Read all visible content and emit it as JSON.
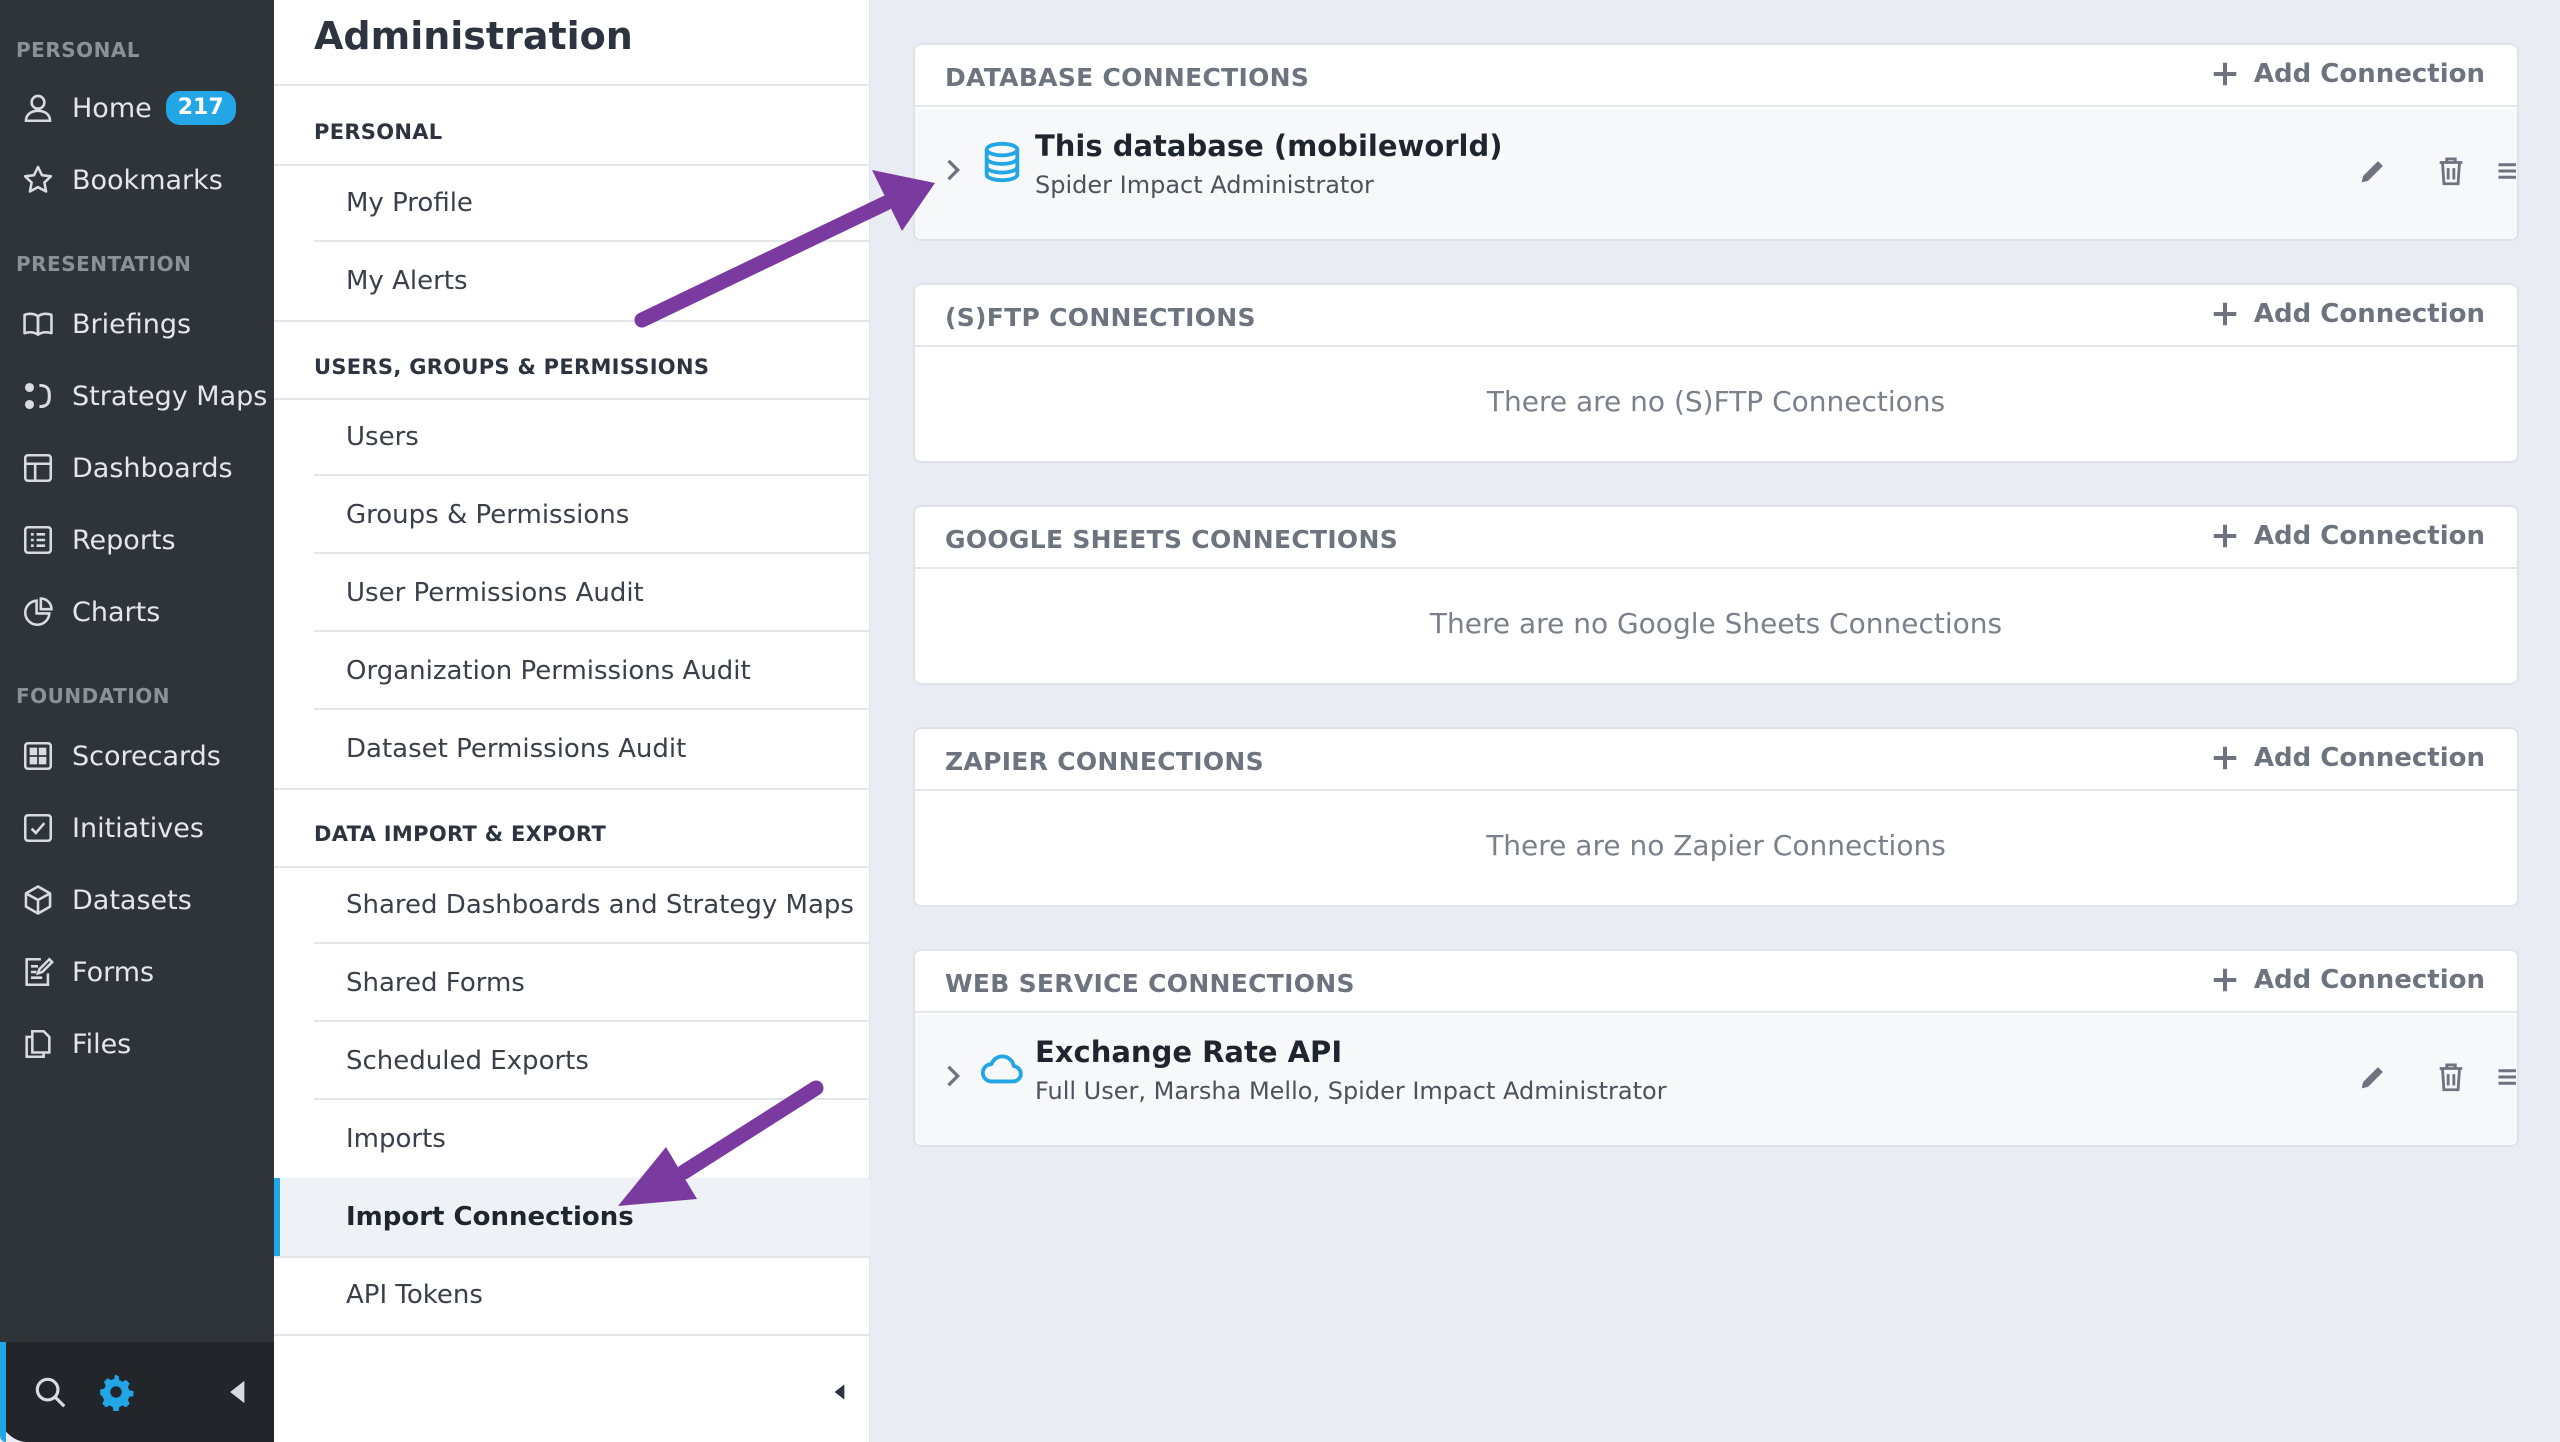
{
  "sidebar": {
    "sections": [
      "PERSONAL",
      "PRESENTATION",
      "FOUNDATION"
    ],
    "items": [
      {
        "label": "Home",
        "icon": "user-icon",
        "badge": "217"
      },
      {
        "label": "Bookmarks",
        "icon": "star-icon"
      },
      {
        "label": "Briefings",
        "icon": "book-icon"
      },
      {
        "label": "Strategy Maps",
        "icon": "strategy-map-icon"
      },
      {
        "label": "Dashboards",
        "icon": "dashboard-icon"
      },
      {
        "label": "Reports",
        "icon": "report-icon"
      },
      {
        "label": "Charts",
        "icon": "pie-chart-icon"
      },
      {
        "label": "Scorecards",
        "icon": "scorecard-icon"
      },
      {
        "label": "Initiatives",
        "icon": "checkbox-icon"
      },
      {
        "label": "Datasets",
        "icon": "cube-icon"
      },
      {
        "label": "Forms",
        "icon": "form-icon"
      },
      {
        "label": "Files",
        "icon": "files-icon"
      }
    ],
    "bottom": {
      "search_icon": "search-icon",
      "settings_icon": "gear-icon",
      "collapse_icon": "caret-left-icon"
    }
  },
  "admin": {
    "title": "Administration",
    "sections": [
      "PERSONAL",
      "USERS, GROUPS & PERMISSIONS",
      "DATA IMPORT & EXPORT"
    ],
    "items": [
      "My Profile",
      "My Alerts",
      "Users",
      "Groups & Permissions",
      "User Permissions Audit",
      "Organization Permissions Audit",
      "Dataset Permissions Audit",
      "Shared Dashboards and Strategy Maps",
      "Shared Forms",
      "Scheduled Exports",
      "Imports",
      "Import Connections",
      "API Tokens"
    ],
    "active_item": "Import Connections"
  },
  "cards": {
    "add_label": "Add Connection",
    "database": {
      "title": "DATABASE CONNECTIONS",
      "row": {
        "name": "This database (mobileworld)",
        "sub": "Spider Impact Administrator",
        "icon": "database-icon"
      }
    },
    "sftp": {
      "title": "(S)FTP CONNECTIONS",
      "empty": "There are no (S)FTP Connections"
    },
    "sheets": {
      "title": "GOOGLE SHEETS CONNECTIONS",
      "empty": "There are no Google Sheets Connections"
    },
    "zapier": {
      "title": "ZAPIER CONNECTIONS",
      "empty": "There are no Zapier Connections"
    },
    "web": {
      "title": "WEB SERVICE CONNECTIONS",
      "row": {
        "name": "Exchange Rate API",
        "sub": "Full User, Marsha Mello, Spider Impact Administrator",
        "icon": "cloud-icon"
      }
    }
  },
  "colors": {
    "accent": "#22a6e6",
    "annotation_arrow": "#7b3aa0",
    "sidebar_bg": "#2f3439"
  }
}
